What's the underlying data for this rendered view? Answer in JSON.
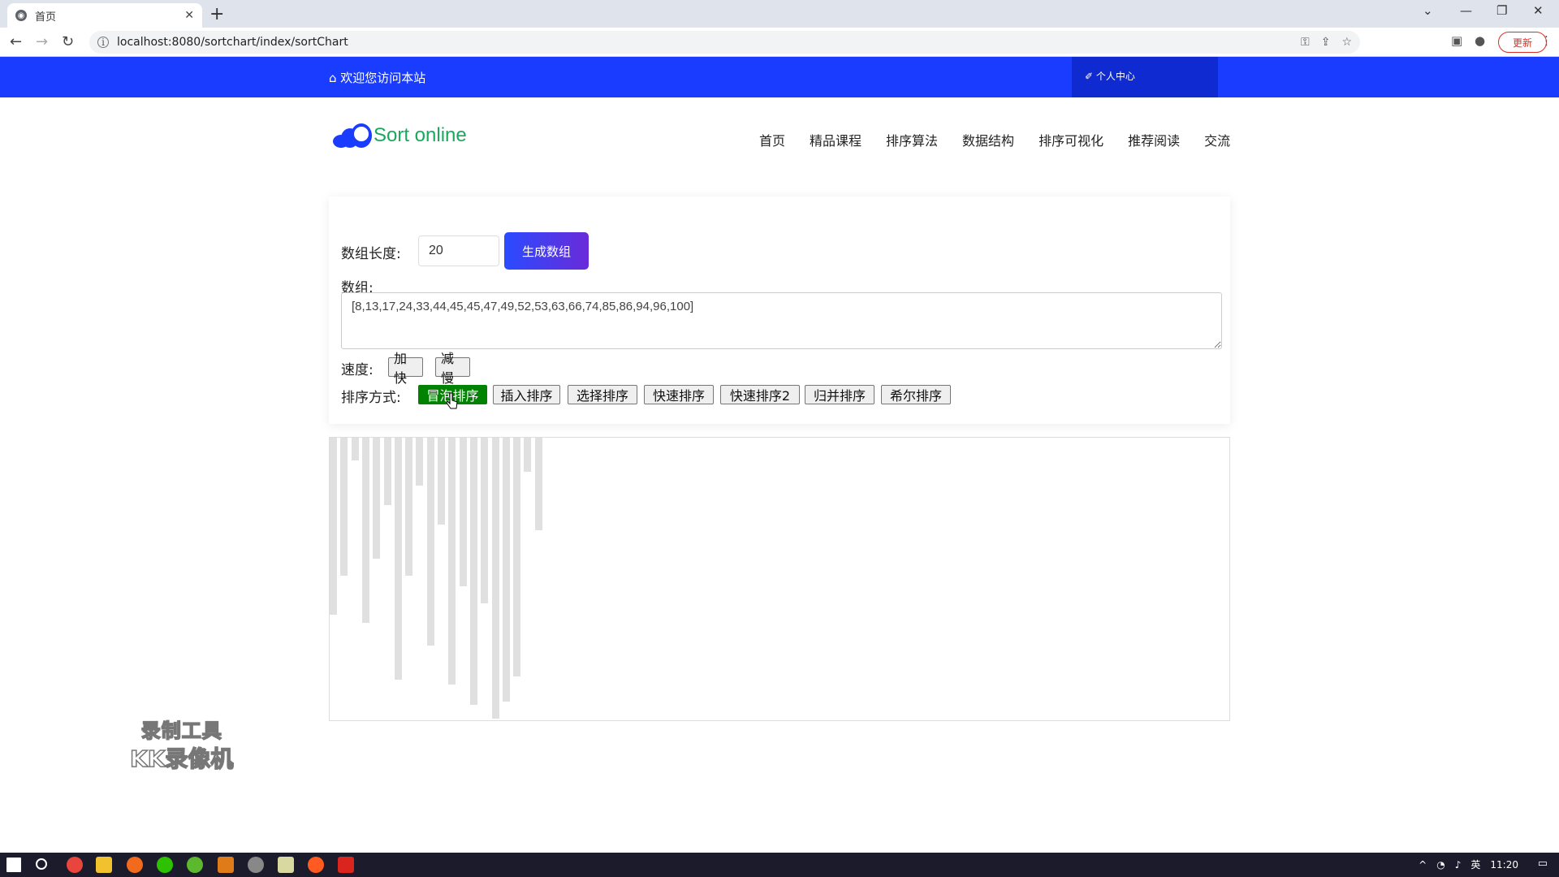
{
  "browser": {
    "tab_title": "首页",
    "tab_close": "✕",
    "new_tab": "+",
    "url": "localhost:8080/sortchart/index/sortChart",
    "update_label": "更新"
  },
  "site": {
    "welcome": "⌂ 欢迎您访问本站",
    "user_center": "✐ 个人中心",
    "brand": "Sort online",
    "nav": [
      "首页",
      "精品课程",
      "排序算法",
      "数据结构",
      "排序可视化",
      "推荐阅读",
      "交流"
    ]
  },
  "controls": {
    "length_label": "数组长度:",
    "length_value": "20",
    "generate_label": "生成数组",
    "array_label": "数组:",
    "array_value": "[8,13,17,24,33,44,45,45,47,49,52,53,63,66,74,85,86,94,96,100]",
    "speed_label": "速度:",
    "speed_up": "加快",
    "speed_down": "减慢",
    "sort_label": "排序方式:",
    "sort_methods": [
      "冒泡排序",
      "插入排序",
      "选择排序",
      "快速排序",
      "快速排序2",
      "归并排序",
      "希尔排序"
    ],
    "active_sort": "冒泡排序"
  },
  "visualization": {
    "bar_color": "#e0e0e0",
    "bar_heights": [
      0.63,
      0.49,
      0.08,
      0.66,
      0.43,
      0.24,
      0.86,
      0.49,
      0.17,
      0.74,
      0.31,
      0.88,
      0.53,
      0.95,
      0.59,
      1.0,
      0.94,
      0.85,
      0.12,
      0.33
    ]
  },
  "watermark": {
    "line1": "录制工具",
    "line2": "KK录像机"
  },
  "taskbar": {
    "ime": "英",
    "time": "11:20"
  }
}
